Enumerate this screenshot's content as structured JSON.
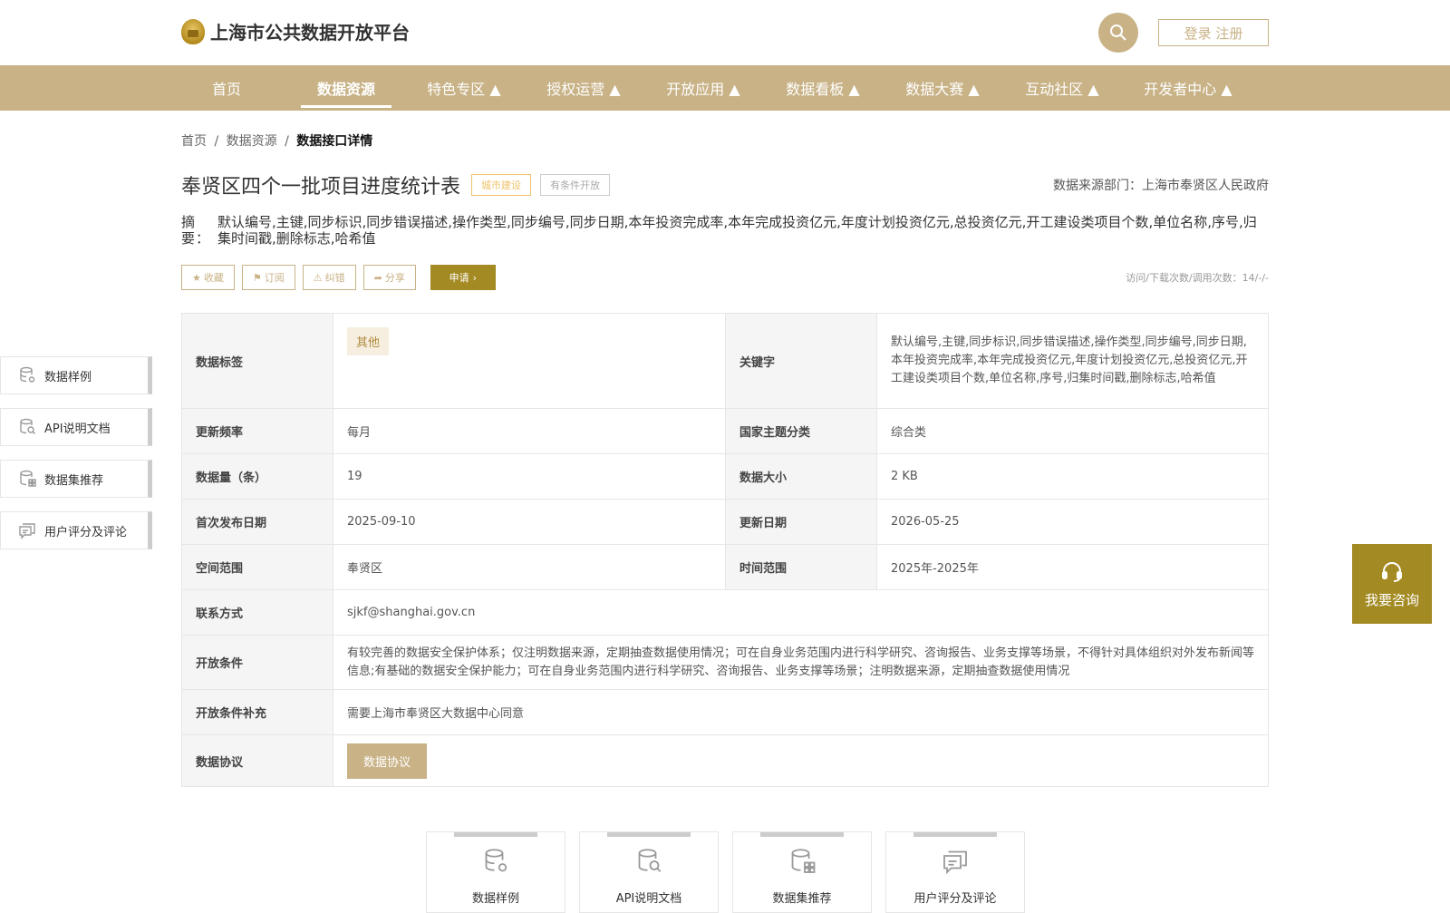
{
  "header": {
    "site_title": "上海市公共数据开放平台",
    "search_icon": "search-icon",
    "login_label": "登录 注册"
  },
  "nav": {
    "items": [
      {
        "label": "首页"
      },
      {
        "label": "数据资源",
        "active": true
      },
      {
        "label": "特色专区 ▲"
      },
      {
        "label": "授权运营 ▲"
      },
      {
        "label": "开放应用 ▲"
      },
      {
        "label": "数据看板 ▲"
      },
      {
        "label": "数据大赛 ▲"
      },
      {
        "label": "互动社区 ▲"
      },
      {
        "label": "开发者中心 ▲"
      }
    ]
  },
  "breadcrumb": {
    "home": "首页",
    "sep": "/",
    "section": "数据资源",
    "current": "数据接口详情"
  },
  "dataset": {
    "title": "奉贤区四个一批项目进度统计表",
    "tag_category": "城市建设",
    "tag_open": "有条件开放",
    "source_dept": "数据来源部门：上海市奉贤区人民政府",
    "summary_label": "摘 要：",
    "summary_text": "默认编号,主键,同步标识,同步错误描述,操作类型,同步编号,同步日期,本年投资完成率,本年完成投资亿元,年度计划投资亿元,总投资亿元,开工建设类项目个数,单位名称,序号,归集时间戳,删除标志,哈希值"
  },
  "actions": {
    "favorite": "收藏",
    "subscribe": "订阅",
    "report": "纠错",
    "share": "分享",
    "apply": "申请",
    "visits": "访问/下载次数/调用次数：14/-/-"
  },
  "table": {
    "row1": {
      "label_a": "数据标签",
      "chip": "其他",
      "label_b": "关键字",
      "value_b": "默认编号,主键,同步标识,同步错误描述,操作类型,同步编号,同步日期,本年投资完成率,本年完成投资亿元,年度计划投资亿元,总投资亿元,开工建设类项目个数,单位名称,序号,归集时间戳,删除标志,哈希值"
    },
    "row2": {
      "label_a": "更新频率",
      "value_a": "每月",
      "label_b": "国家主题分类",
      "value_b": "综合类"
    },
    "row3": {
      "label_a": "数据量（条）",
      "value_a": "19",
      "label_b": "数据大小",
      "value_b": "2 KB"
    },
    "row4": {
      "label_a": "首次发布日期",
      "value_a": "2025-09-10",
      "label_b": "更新日期",
      "value_b": "2026-05-25"
    },
    "row5": {
      "label_a": "空间范围",
      "value_a": "奉贤区",
      "label_b": "时间范围",
      "value_b": "2025年-2025年"
    },
    "row6": {
      "label": "联系方式",
      "value": "sjkf@shanghai.gov.cn"
    },
    "row7": {
      "label": "开放条件",
      "value": "有较完善的数据安全保护体系；仅注明数据来源，定期抽查数据使用情况；可在自身业务范围内进行科学研究、咨询报告、业务支撑等场景，不得针对具体组织对外发布新闻等信息;有基础的数据安全保护能力；可在自身业务范围内进行科学研究、咨询报告、业务支撑等场景；注明数据来源，定期抽查数据使用情况"
    },
    "row8": {
      "label": "开放条件补充",
      "value": "需要上海市奉贤区大数据中心同意"
    },
    "row9": {
      "label": "数据协议",
      "button": "数据协议"
    }
  },
  "side_nav": {
    "items": [
      {
        "label": "数据样例",
        "icon": "database-gear-icon"
      },
      {
        "label": "API说明文档",
        "icon": "document-search-icon"
      },
      {
        "label": "数据集推荐",
        "icon": "database-grid-icon"
      },
      {
        "label": "用户评分及评论",
        "icon": "comment-icon"
      }
    ]
  },
  "consult": {
    "label": "我要咨询",
    "icon": "headset-icon"
  },
  "bottom_cards": {
    "items": [
      {
        "label": "数据样例"
      },
      {
        "label": "API说明文档"
      },
      {
        "label": "数据集推荐"
      },
      {
        "label": "用户评分及评论"
      }
    ]
  },
  "colors": {
    "brand": "#c8b286",
    "accent_dark": "#a38a23",
    "tag_orange": "#f0c36b"
  }
}
